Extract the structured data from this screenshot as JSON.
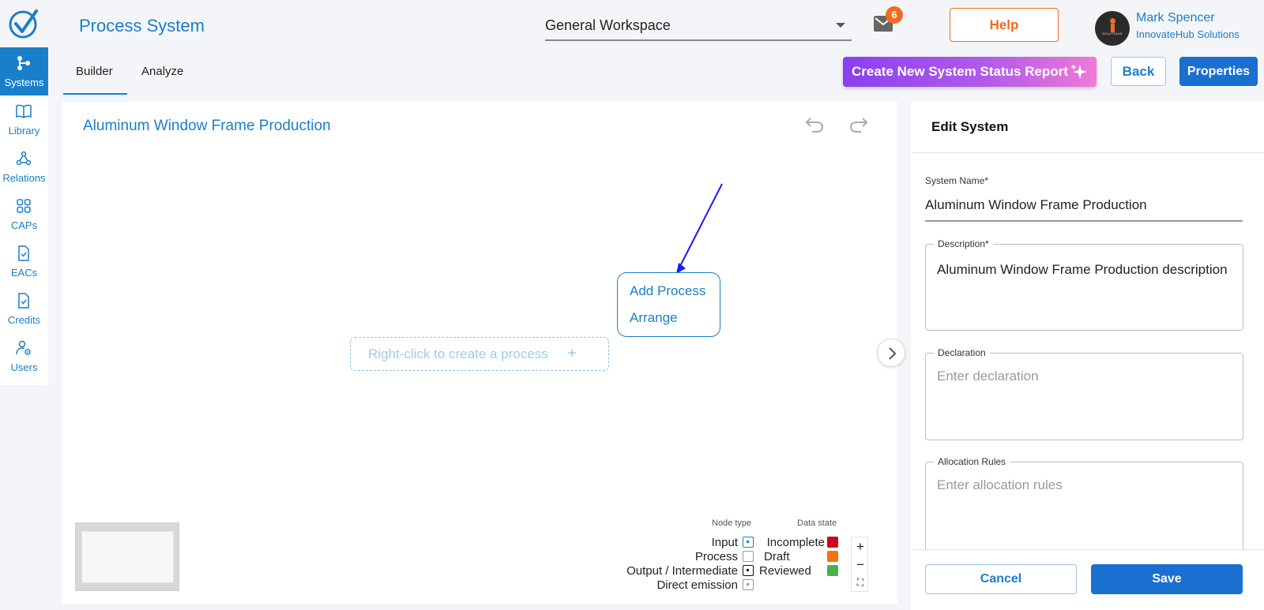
{
  "app": {
    "title": "Process System"
  },
  "header": {
    "workspace": "General Workspace",
    "mail_count": "6",
    "help_label": "Help",
    "user_name": "Mark Spencer",
    "user_org": "InnovateHub Solutions",
    "avatar_text": "SOLUTIONS"
  },
  "sidebar": {
    "items": [
      {
        "label": "Systems",
        "icon": "systems-icon",
        "active": true
      },
      {
        "label": "Library",
        "icon": "book-icon"
      },
      {
        "label": "Relations",
        "icon": "relations-icon"
      },
      {
        "label": "CAPs",
        "icon": "grid-icon"
      },
      {
        "label": "EACs",
        "icon": "doc-check-icon"
      },
      {
        "label": "Credits",
        "icon": "doc-check-icon"
      },
      {
        "label": "Users",
        "icon": "users-settings-icon"
      }
    ]
  },
  "tabs": [
    {
      "label": "Builder",
      "active": true
    },
    {
      "label": "Analyze"
    }
  ],
  "toolbar": {
    "create_report_label": "Create New System Status Report",
    "back_label": "Back",
    "properties_label": "Properties"
  },
  "canvas": {
    "title": "Aluminum Window Frame Production",
    "placeholder": "Right-click to create a process",
    "placeholder_icon": "+",
    "context_menu": [
      "Add Process",
      "Arrange"
    ]
  },
  "legend": {
    "node_type_title": "Node type",
    "data_state_title": "Data state",
    "node_types": [
      "Input",
      "Process",
      "Output / Intermediate",
      "Direct emission"
    ],
    "data_states": [
      {
        "label": "Incomplete",
        "color": "#d0021b"
      },
      {
        "label": "Draft",
        "color": "#f5730f"
      },
      {
        "label": "Reviewed",
        "color": "#4caf50"
      }
    ]
  },
  "zoom": {
    "in": "+",
    "out": "−",
    "fit": "⛶"
  },
  "panel": {
    "title": "Edit System",
    "system_name_label": "System Name",
    "system_name_value": "Aluminum Window Frame Production",
    "description_label": "Description",
    "description_value": "Aluminum Window Frame Production description",
    "declaration_label": "Declaration",
    "declaration_placeholder": "Enter declaration",
    "allocation_label": "Allocation Rules",
    "allocation_placeholder": "Enter allocation rules",
    "required_mark": "*",
    "cancel_label": "Cancel",
    "save_label": "Save"
  },
  "colors": {
    "accent": "#1a7fc9",
    "orange": "#f26b1d",
    "primary_button": "#1a6fd1"
  }
}
